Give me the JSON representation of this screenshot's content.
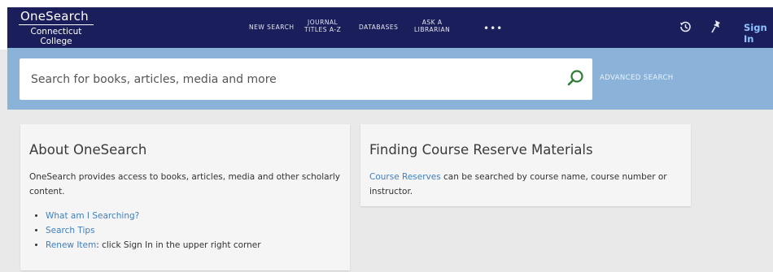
{
  "header": {
    "brand": "OneSearch",
    "college_line1": "Connecticut",
    "college_line2": "College",
    "nav": [
      {
        "label": "NEW SEARCH"
      },
      {
        "label_line1": "JOURNAL",
        "label_line2": "TITLES A-Z"
      },
      {
        "label": "DATABASES"
      },
      {
        "label_line1": "ASK A",
        "label_line2": "LIBRARIAN"
      }
    ],
    "more": "•••",
    "history_icon": "history-icon",
    "pin_icon": "pin-icon",
    "sign_in": "Sign In"
  },
  "search": {
    "placeholder": "Search for books, articles, media and more",
    "value": "",
    "advanced": "ADVANCED SEARCH"
  },
  "about": {
    "title": "About OneSearch",
    "body": "OneSearch provides access to books, articles, media and other scholarly content.",
    "items": [
      {
        "link": "What am I Searching?",
        "text": ""
      },
      {
        "link": "Search Tips",
        "text": ""
      },
      {
        "link": "Renew Item",
        "text": ": click Sign In in the upper right corner"
      }
    ]
  },
  "reserves": {
    "title": "Finding Course Reserve Materials",
    "link": "Course Reserves",
    "body": " can be searched by course name, course number or instructor."
  },
  "colors": {
    "navbar": "#1a1e5a",
    "search_band": "#8bb3da",
    "link": "#3f7fc0",
    "sign_in": "#8ec3ff",
    "search_icon": "#2e7d32"
  }
}
